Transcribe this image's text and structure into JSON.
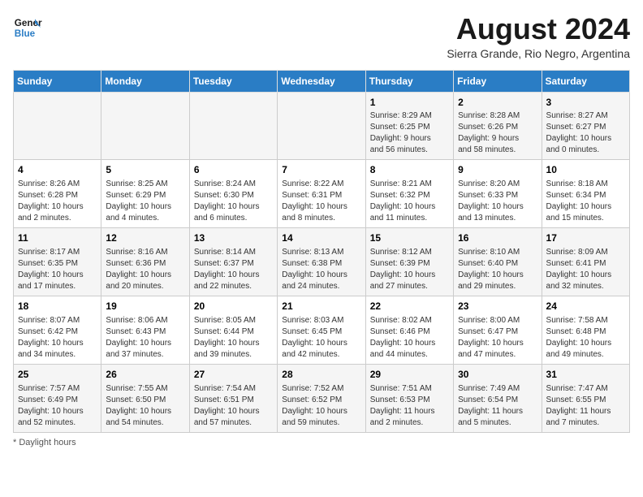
{
  "header": {
    "logo_line1": "General",
    "logo_line2": "Blue",
    "main_title": "August 2024",
    "subtitle": "Sierra Grande, Rio Negro, Argentina"
  },
  "footer": {
    "note": "Daylight hours"
  },
  "days_of_week": [
    "Sunday",
    "Monday",
    "Tuesday",
    "Wednesday",
    "Thursday",
    "Friday",
    "Saturday"
  ],
  "weeks": [
    [
      {
        "num": "",
        "info": ""
      },
      {
        "num": "",
        "info": ""
      },
      {
        "num": "",
        "info": ""
      },
      {
        "num": "",
        "info": ""
      },
      {
        "num": "1",
        "info": "Sunrise: 8:29 AM\nSunset: 6:25 PM\nDaylight: 9 hours\nand 56 minutes."
      },
      {
        "num": "2",
        "info": "Sunrise: 8:28 AM\nSunset: 6:26 PM\nDaylight: 9 hours\nand 58 minutes."
      },
      {
        "num": "3",
        "info": "Sunrise: 8:27 AM\nSunset: 6:27 PM\nDaylight: 10 hours\nand 0 minutes."
      }
    ],
    [
      {
        "num": "4",
        "info": "Sunrise: 8:26 AM\nSunset: 6:28 PM\nDaylight: 10 hours\nand 2 minutes."
      },
      {
        "num": "5",
        "info": "Sunrise: 8:25 AM\nSunset: 6:29 PM\nDaylight: 10 hours\nand 4 minutes."
      },
      {
        "num": "6",
        "info": "Sunrise: 8:24 AM\nSunset: 6:30 PM\nDaylight: 10 hours\nand 6 minutes."
      },
      {
        "num": "7",
        "info": "Sunrise: 8:22 AM\nSunset: 6:31 PM\nDaylight: 10 hours\nand 8 minutes."
      },
      {
        "num": "8",
        "info": "Sunrise: 8:21 AM\nSunset: 6:32 PM\nDaylight: 10 hours\nand 11 minutes."
      },
      {
        "num": "9",
        "info": "Sunrise: 8:20 AM\nSunset: 6:33 PM\nDaylight: 10 hours\nand 13 minutes."
      },
      {
        "num": "10",
        "info": "Sunrise: 8:18 AM\nSunset: 6:34 PM\nDaylight: 10 hours\nand 15 minutes."
      }
    ],
    [
      {
        "num": "11",
        "info": "Sunrise: 8:17 AM\nSunset: 6:35 PM\nDaylight: 10 hours\nand 17 minutes."
      },
      {
        "num": "12",
        "info": "Sunrise: 8:16 AM\nSunset: 6:36 PM\nDaylight: 10 hours\nand 20 minutes."
      },
      {
        "num": "13",
        "info": "Sunrise: 8:14 AM\nSunset: 6:37 PM\nDaylight: 10 hours\nand 22 minutes."
      },
      {
        "num": "14",
        "info": "Sunrise: 8:13 AM\nSunset: 6:38 PM\nDaylight: 10 hours\nand 24 minutes."
      },
      {
        "num": "15",
        "info": "Sunrise: 8:12 AM\nSunset: 6:39 PM\nDaylight: 10 hours\nand 27 minutes."
      },
      {
        "num": "16",
        "info": "Sunrise: 8:10 AM\nSunset: 6:40 PM\nDaylight: 10 hours\nand 29 minutes."
      },
      {
        "num": "17",
        "info": "Sunrise: 8:09 AM\nSunset: 6:41 PM\nDaylight: 10 hours\nand 32 minutes."
      }
    ],
    [
      {
        "num": "18",
        "info": "Sunrise: 8:07 AM\nSunset: 6:42 PM\nDaylight: 10 hours\nand 34 minutes."
      },
      {
        "num": "19",
        "info": "Sunrise: 8:06 AM\nSunset: 6:43 PM\nDaylight: 10 hours\nand 37 minutes."
      },
      {
        "num": "20",
        "info": "Sunrise: 8:05 AM\nSunset: 6:44 PM\nDaylight: 10 hours\nand 39 minutes."
      },
      {
        "num": "21",
        "info": "Sunrise: 8:03 AM\nSunset: 6:45 PM\nDaylight: 10 hours\nand 42 minutes."
      },
      {
        "num": "22",
        "info": "Sunrise: 8:02 AM\nSunset: 6:46 PM\nDaylight: 10 hours\nand 44 minutes."
      },
      {
        "num": "23",
        "info": "Sunrise: 8:00 AM\nSunset: 6:47 PM\nDaylight: 10 hours\nand 47 minutes."
      },
      {
        "num": "24",
        "info": "Sunrise: 7:58 AM\nSunset: 6:48 PM\nDaylight: 10 hours\nand 49 minutes."
      }
    ],
    [
      {
        "num": "25",
        "info": "Sunrise: 7:57 AM\nSunset: 6:49 PM\nDaylight: 10 hours\nand 52 minutes."
      },
      {
        "num": "26",
        "info": "Sunrise: 7:55 AM\nSunset: 6:50 PM\nDaylight: 10 hours\nand 54 minutes."
      },
      {
        "num": "27",
        "info": "Sunrise: 7:54 AM\nSunset: 6:51 PM\nDaylight: 10 hours\nand 57 minutes."
      },
      {
        "num": "28",
        "info": "Sunrise: 7:52 AM\nSunset: 6:52 PM\nDaylight: 10 hours\nand 59 minutes."
      },
      {
        "num": "29",
        "info": "Sunrise: 7:51 AM\nSunset: 6:53 PM\nDaylight: 11 hours\nand 2 minutes."
      },
      {
        "num": "30",
        "info": "Sunrise: 7:49 AM\nSunset: 6:54 PM\nDaylight: 11 hours\nand 5 minutes."
      },
      {
        "num": "31",
        "info": "Sunrise: 7:47 AM\nSunset: 6:55 PM\nDaylight: 11 hours\nand 7 minutes."
      }
    ]
  ]
}
